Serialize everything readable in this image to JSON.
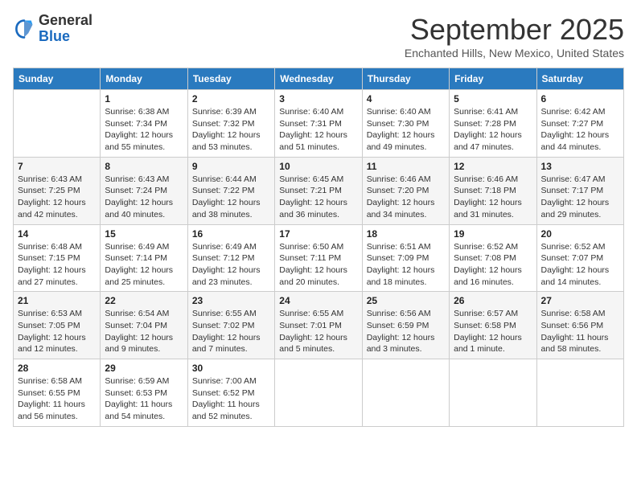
{
  "header": {
    "logo_general": "General",
    "logo_blue": "Blue",
    "month_title": "September 2025",
    "location": "Enchanted Hills, New Mexico, United States"
  },
  "days_of_week": [
    "Sunday",
    "Monday",
    "Tuesday",
    "Wednesday",
    "Thursday",
    "Friday",
    "Saturday"
  ],
  "weeks": [
    [
      {
        "day": "",
        "info": ""
      },
      {
        "day": "1",
        "info": "Sunrise: 6:38 AM\nSunset: 7:34 PM\nDaylight: 12 hours\nand 55 minutes."
      },
      {
        "day": "2",
        "info": "Sunrise: 6:39 AM\nSunset: 7:32 PM\nDaylight: 12 hours\nand 53 minutes."
      },
      {
        "day": "3",
        "info": "Sunrise: 6:40 AM\nSunset: 7:31 PM\nDaylight: 12 hours\nand 51 minutes."
      },
      {
        "day": "4",
        "info": "Sunrise: 6:40 AM\nSunset: 7:30 PM\nDaylight: 12 hours\nand 49 minutes."
      },
      {
        "day": "5",
        "info": "Sunrise: 6:41 AM\nSunset: 7:28 PM\nDaylight: 12 hours\nand 47 minutes."
      },
      {
        "day": "6",
        "info": "Sunrise: 6:42 AM\nSunset: 7:27 PM\nDaylight: 12 hours\nand 44 minutes."
      }
    ],
    [
      {
        "day": "7",
        "info": "Sunrise: 6:43 AM\nSunset: 7:25 PM\nDaylight: 12 hours\nand 42 minutes."
      },
      {
        "day": "8",
        "info": "Sunrise: 6:43 AM\nSunset: 7:24 PM\nDaylight: 12 hours\nand 40 minutes."
      },
      {
        "day": "9",
        "info": "Sunrise: 6:44 AM\nSunset: 7:22 PM\nDaylight: 12 hours\nand 38 minutes."
      },
      {
        "day": "10",
        "info": "Sunrise: 6:45 AM\nSunset: 7:21 PM\nDaylight: 12 hours\nand 36 minutes."
      },
      {
        "day": "11",
        "info": "Sunrise: 6:46 AM\nSunset: 7:20 PM\nDaylight: 12 hours\nand 34 minutes."
      },
      {
        "day": "12",
        "info": "Sunrise: 6:46 AM\nSunset: 7:18 PM\nDaylight: 12 hours\nand 31 minutes."
      },
      {
        "day": "13",
        "info": "Sunrise: 6:47 AM\nSunset: 7:17 PM\nDaylight: 12 hours\nand 29 minutes."
      }
    ],
    [
      {
        "day": "14",
        "info": "Sunrise: 6:48 AM\nSunset: 7:15 PM\nDaylight: 12 hours\nand 27 minutes."
      },
      {
        "day": "15",
        "info": "Sunrise: 6:49 AM\nSunset: 7:14 PM\nDaylight: 12 hours\nand 25 minutes."
      },
      {
        "day": "16",
        "info": "Sunrise: 6:49 AM\nSunset: 7:12 PM\nDaylight: 12 hours\nand 23 minutes."
      },
      {
        "day": "17",
        "info": "Sunrise: 6:50 AM\nSunset: 7:11 PM\nDaylight: 12 hours\nand 20 minutes."
      },
      {
        "day": "18",
        "info": "Sunrise: 6:51 AM\nSunset: 7:09 PM\nDaylight: 12 hours\nand 18 minutes."
      },
      {
        "day": "19",
        "info": "Sunrise: 6:52 AM\nSunset: 7:08 PM\nDaylight: 12 hours\nand 16 minutes."
      },
      {
        "day": "20",
        "info": "Sunrise: 6:52 AM\nSunset: 7:07 PM\nDaylight: 12 hours\nand 14 minutes."
      }
    ],
    [
      {
        "day": "21",
        "info": "Sunrise: 6:53 AM\nSunset: 7:05 PM\nDaylight: 12 hours\nand 12 minutes."
      },
      {
        "day": "22",
        "info": "Sunrise: 6:54 AM\nSunset: 7:04 PM\nDaylight: 12 hours\nand 9 minutes."
      },
      {
        "day": "23",
        "info": "Sunrise: 6:55 AM\nSunset: 7:02 PM\nDaylight: 12 hours\nand 7 minutes."
      },
      {
        "day": "24",
        "info": "Sunrise: 6:55 AM\nSunset: 7:01 PM\nDaylight: 12 hours\nand 5 minutes."
      },
      {
        "day": "25",
        "info": "Sunrise: 6:56 AM\nSunset: 6:59 PM\nDaylight: 12 hours\nand 3 minutes."
      },
      {
        "day": "26",
        "info": "Sunrise: 6:57 AM\nSunset: 6:58 PM\nDaylight: 12 hours\nand 1 minute."
      },
      {
        "day": "27",
        "info": "Sunrise: 6:58 AM\nSunset: 6:56 PM\nDaylight: 11 hours\nand 58 minutes."
      }
    ],
    [
      {
        "day": "28",
        "info": "Sunrise: 6:58 AM\nSunset: 6:55 PM\nDaylight: 11 hours\nand 56 minutes."
      },
      {
        "day": "29",
        "info": "Sunrise: 6:59 AM\nSunset: 6:53 PM\nDaylight: 11 hours\nand 54 minutes."
      },
      {
        "day": "30",
        "info": "Sunrise: 7:00 AM\nSunset: 6:52 PM\nDaylight: 11 hours\nand 52 minutes."
      },
      {
        "day": "",
        "info": ""
      },
      {
        "day": "",
        "info": ""
      },
      {
        "day": "",
        "info": ""
      },
      {
        "day": "",
        "info": ""
      }
    ]
  ]
}
